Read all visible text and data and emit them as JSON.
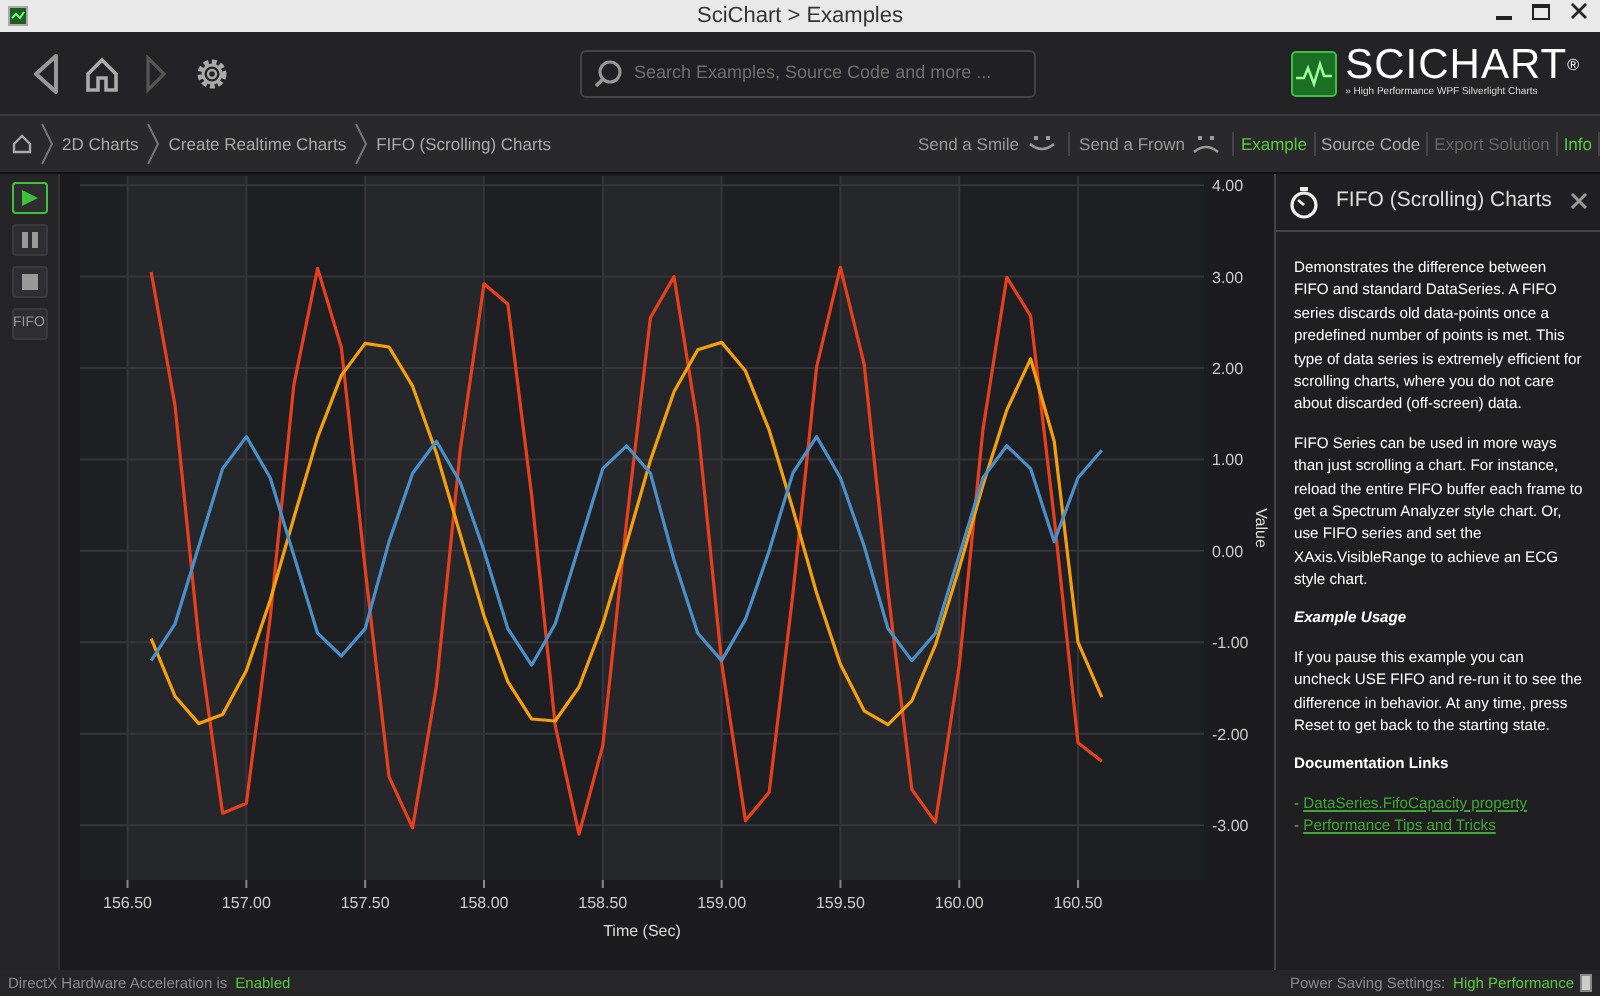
{
  "window": {
    "title": "SciChart > Examples"
  },
  "toolbar": {
    "search": {
      "placeholder": "Search Examples, Source Code and more ..."
    },
    "logo": {
      "name": "SCICHART$^{®}$",
      "tagline": "» High Performance WPF Silverlight Charts"
    }
  },
  "breadcrumb": [
    "2D Charts",
    "Create Realtime Charts",
    "FIFO (Scrolling) Charts"
  ],
  "feedback": [
    {
      "label": "Send a Smile",
      "kind": "smile"
    },
    {
      "label": "Send a Frown",
      "kind": "frown"
    }
  ],
  "view_tabs": [
    {
      "label": "Example",
      "selected": true,
      "disabled": false
    },
    {
      "label": "Source Code",
      "selected": false,
      "disabled": false
    },
    {
      "label": "Export Solution",
      "selected": false,
      "disabled": true
    },
    {
      "label": "Info",
      "selected": true,
      "disabled": false
    }
  ],
  "chart_controls": [
    {
      "kind": "play",
      "selected": true
    },
    {
      "kind": "pause",
      "selected": false
    },
    {
      "kind": "stop",
      "selected": false
    },
    {
      "kind": "text",
      "label": "FIFO",
      "selected": false
    }
  ],
  "chart": {
    "chart_data": {
      "type": "line",
      "xlabel": "Time (Sec)",
      "ylabel": "Value",
      "x": [
        156.6,
        156.7,
        156.8,
        156.9,
        157.0,
        157.1,
        157.2,
        157.3,
        157.4,
        157.5,
        157.6,
        157.7,
        157.8,
        157.9,
        158.0,
        158.1,
        158.2,
        158.3,
        158.4,
        158.5,
        158.6,
        158.7,
        158.8,
        158.9,
        159.0,
        159.1,
        159.2,
        159.3,
        159.4,
        159.5,
        159.6,
        159.7,
        159.8,
        159.9,
        160.0,
        160.1,
        160.2,
        160.3,
        160.4,
        160.5,
        160.6
      ],
      "series": [
        {
          "color": "#e8401c",
          "values": [
            3.05,
            1.59,
            -0.98,
            -2.87,
            -2.76,
            -0.73,
            1.81,
            3.09,
            2.22,
            -0.2,
            -2.47,
            -3.03,
            -1.48,
            1.1,
            2.92,
            2.7,
            0.61,
            -1.91,
            -3.1,
            -2.13,
            0.32,
            2.55,
            3.0,
            1.37,
            -1.22,
            -2.95,
            -2.64,
            -0.48,
            2.01,
            3.1,
            2.04,
            -0.44,
            -2.61,
            -2.97,
            -1.26,
            1.33,
            2.99,
            2.57,
            0.36,
            -2.1,
            -2.3
          ]
        },
        {
          "color": "#f5a00a",
          "values": [
            -0.96,
            -1.59,
            -1.89,
            -1.79,
            -1.31,
            -0.54,
            0.36,
            1.24,
            1.92,
            2.27,
            2.23,
            1.8,
            1.07,
            0.18,
            -0.71,
            -1.43,
            -1.84,
            -1.86,
            -1.49,
            -0.8,
            0.08,
            0.99,
            1.74,
            2.2,
            2.28,
            1.97,
            1.32,
            0.46,
            -0.46,
            -1.24,
            -1.75,
            -1.9,
            -1.64,
            -1.03,
            -0.19,
            0.72,
            1.54,
            2.1,
            1.2,
            -1.0,
            -1.6
          ]
        },
        {
          "color": "#4a90c8",
          "values": [
            -1.2,
            -0.8,
            0.05,
            0.9,
            1.25,
            0.8,
            -0.05,
            -0.9,
            -1.15,
            -0.85,
            0.1,
            0.85,
            1.2,
            0.75,
            0.0,
            -0.85,
            -1.25,
            -0.8,
            0.05,
            0.9,
            1.15,
            0.85,
            -0.1,
            -0.9,
            -1.2,
            -0.75,
            0.0,
            0.85,
            1.25,
            0.8,
            0.05,
            -0.85,
            -1.2,
            -0.9,
            -0.05,
            0.8,
            1.15,
            0.9,
            0.1,
            0.8,
            1.1
          ]
        }
      ],
      "grid": true,
      "xlim": [
        156.3,
        161.03
      ],
      "ylim": [
        -3.6,
        4.1
      ],
      "xticks": [
        {
          "value": 156.5,
          "label": "156.50"
        },
        {
          "value": 157,
          "label": "157.00"
        },
        {
          "value": 157.5,
          "label": "157.50"
        },
        {
          "value": 158,
          "label": "158.00"
        },
        {
          "value": 158.5,
          "label": "158.50"
        },
        {
          "value": 159,
          "label": "159.00"
        },
        {
          "value": 159.5,
          "label": "159.50"
        },
        {
          "value": 160,
          "label": "160.00"
        },
        {
          "value": 160.5,
          "label": "160.50"
        }
      ],
      "yticks": [
        {
          "value": -3,
          "label": "-3.00"
        },
        {
          "value": -2,
          "label": "-2.00"
        },
        {
          "value": -1,
          "label": "-1.00"
        },
        {
          "value": 0,
          "label": "0.00"
        },
        {
          "value": 1,
          "label": "1.00"
        },
        {
          "value": 2,
          "label": "2.00"
        },
        {
          "value": 3,
          "label": "3.00"
        },
        {
          "value": 4,
          "label": "4.00"
        }
      ]
    }
  },
  "info_panel": {
    "title": "FIFO (Scrolling) Charts",
    "blocks": [
      {
        "kind": "paragraph",
        "text": "Demonstrates the difference between FIFO and standard DataSeries. A FIFO series discards old data-points once a predefined number of points is met. This type of data series is extremely efficient for scrolling charts, where you do not care about discarded (off-screen) data."
      },
      {
        "kind": "paragraph",
        "text": "FIFO Series can be used in more ways than just scrolling a chart. For instance, reload the entire FIFO buffer each frame to get a Spectrum Analyzer style chart. Or, use FIFO series and set the XAxis.VisibleRange to achieve an ECG style chart."
      },
      {
        "kind": "subheading",
        "text": "Example Usage"
      },
      {
        "kind": "paragraph",
        "text": "If you pause this example you can uncheck USE FIFO and re-run it to see the difference in behavior. At any time, press Reset to get back to the starting state."
      },
      {
        "kind": "heading",
        "text": "Documentation Links"
      },
      {
        "kind": "links",
        "items": [
          {
            "marker": "-",
            "label": "DataSeries.FifoCapacity property"
          },
          {
            "marker": "-",
            "label": "Performance Tips and Tricks"
          }
        ]
      }
    ]
  },
  "status_bar": {
    "acceleration_label": "DirectX Hardware Acceleration is",
    "acceleration_value": "Enabled",
    "power_label": "Power Saving Settings:",
    "power_value": "High Performance"
  }
}
